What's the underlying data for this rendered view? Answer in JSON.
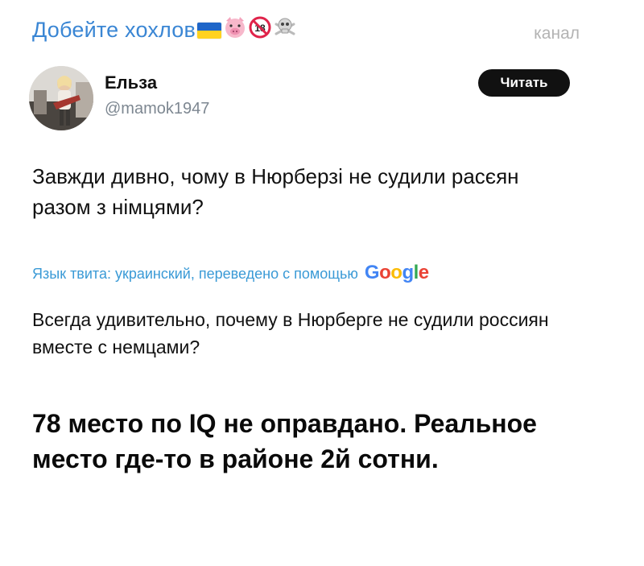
{
  "channel": {
    "title": "Добейте хохлов",
    "title_emojis": [
      "flag-ukraine-icon",
      "pig-face-icon",
      "no-under-18-icon",
      "skull-crossbones-icon"
    ],
    "label": "канал"
  },
  "tweet": {
    "author_name": "Ельза",
    "author_handle": "@mamok1947",
    "read_button_label": "Читать",
    "text": "Завжди дивно, чому в Нюрберзі не судили расєян разом з німцями?",
    "translation_note": "Язык твита: украинский, переведено с помощью",
    "translation_provider": "Google",
    "translated_text": "Всегда удивительно, почему в Нюрберге не судили россиян вместе с немцами?"
  },
  "caption": {
    "text": "78 место по IQ не оправдано. Реальное место где-то в районе 2й сотни."
  },
  "colors": {
    "channel_title": "#3a86d4",
    "channel_label": "#b3b3b3",
    "handle": "#7d8791",
    "translation_note": "#3a9ad6",
    "button_bg": "#111111",
    "google_blue": "#4285F4",
    "google_red": "#EA4335",
    "google_yellow": "#FBBC05",
    "google_green": "#34A853"
  }
}
